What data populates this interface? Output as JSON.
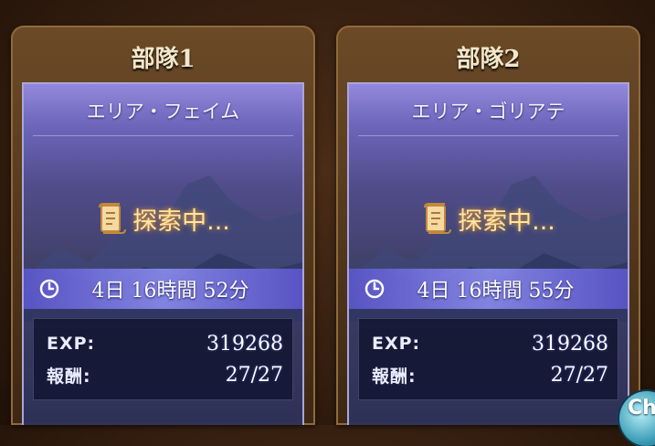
{
  "parties": [
    {
      "tab_label": "部隊1",
      "area_name": "エリア・フェイム",
      "status": "探索中...",
      "timer": "4日 16時間 52分",
      "exp_label": "EXP:",
      "exp_value": "319268",
      "reward_label": "報酬:",
      "reward_value": "27/27"
    },
    {
      "tab_label": "部隊2",
      "area_name": "エリア・ゴリアテ",
      "status": "探索中...",
      "timer": "4日 16時間 55分",
      "exp_label": "EXP:",
      "exp_value": "319268",
      "reward_label": "報酬:",
      "reward_value": "27/27"
    }
  ],
  "corner_button": {
    "label": "Ch"
  },
  "colors": {
    "frame": "#6c4a27",
    "panel_top": "#968ce6",
    "status_glow": "#ffb845",
    "stats_bg": "#121632"
  }
}
